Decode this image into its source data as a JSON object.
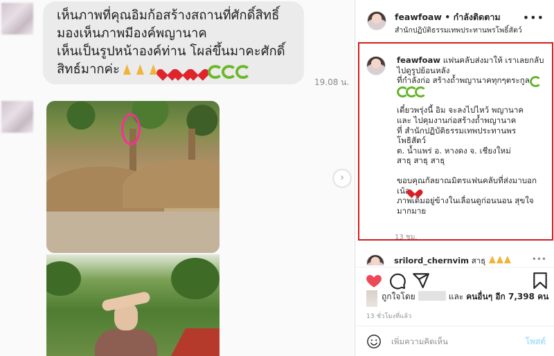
{
  "chat": {
    "bubble_lines": [
      "เห็นภาพที่คุณอิมก้อสร้างสถานที่ศักดิ์สิทธิ์",
      "มองเห็นภาพมีองค์พญานาค",
      "เห็นเป็นรูปหน้าองค์ท่าน โผล่ขึ้นมาคะศักดิ์",
      "สิทธ์มากค่ะ"
    ],
    "timestamp": "19.08 น."
  },
  "header": {
    "username": "feawfoaw",
    "separator": " • ",
    "follow_status": "กำลังติดตาม",
    "location": "สำนักปฏิบัติธรรมเทพประทานพรโพธิ์สัตว์",
    "more_icon": "more-horizontal-icon"
  },
  "caption": {
    "username": "feawfoaw",
    "para1": [
      "แฟนคลับส่งมาให้ เราเลยกลับ",
      "ไปดูรูปย้อนหลัง",
      "ที่กำลังก่อ สร้างถ้ำพญานาคทุกๆตระกูล"
    ],
    "para2": [
      "เดี๋ยวพรุ่งนี้ อิม จะลงไปไหว้ พญานาค",
      "และ ไปคุมงานก่อสร้างถ้ำพญานาค",
      "ที่ สำนักปฏิบัติธรรมเทพประทานพร",
      "โพธิสัตว์",
      "ต. น้ำแพร่ อ. หางดง จ. เชียงใหม่",
      "สาธุ สาธุ สาธุ"
    ],
    "para3": [
      "ขอบคุณกัลยาณมิตรแฟนคลับที่ส่งมาบอก",
      "เน้อ",
      "ภาพเดิมอยู่ข้างในเลื่อนดูก่อนนอน สุขใจ",
      "มากมาย"
    ],
    "time": "13 ชม."
  },
  "comment": {
    "username": "srilord_chernvim",
    "text": " สาธุ ",
    "more_icon": "more-horizontal-icon"
  },
  "likes": {
    "prefix": "ถูกใจโดย",
    "middle": "และ ",
    "others": "คนอื่นๆ อีก 7,398 คน"
  },
  "post_time": "13 ชั่วโมงที่แล้ว",
  "add_comment": {
    "placeholder": "เพิ่มความคิดเห็น",
    "post_label": "โพสต์"
  },
  "colors": {
    "highlight_border": "#d41a1a",
    "like_heart": "#ed4956",
    "post_button_disabled": "#b2dffc"
  }
}
